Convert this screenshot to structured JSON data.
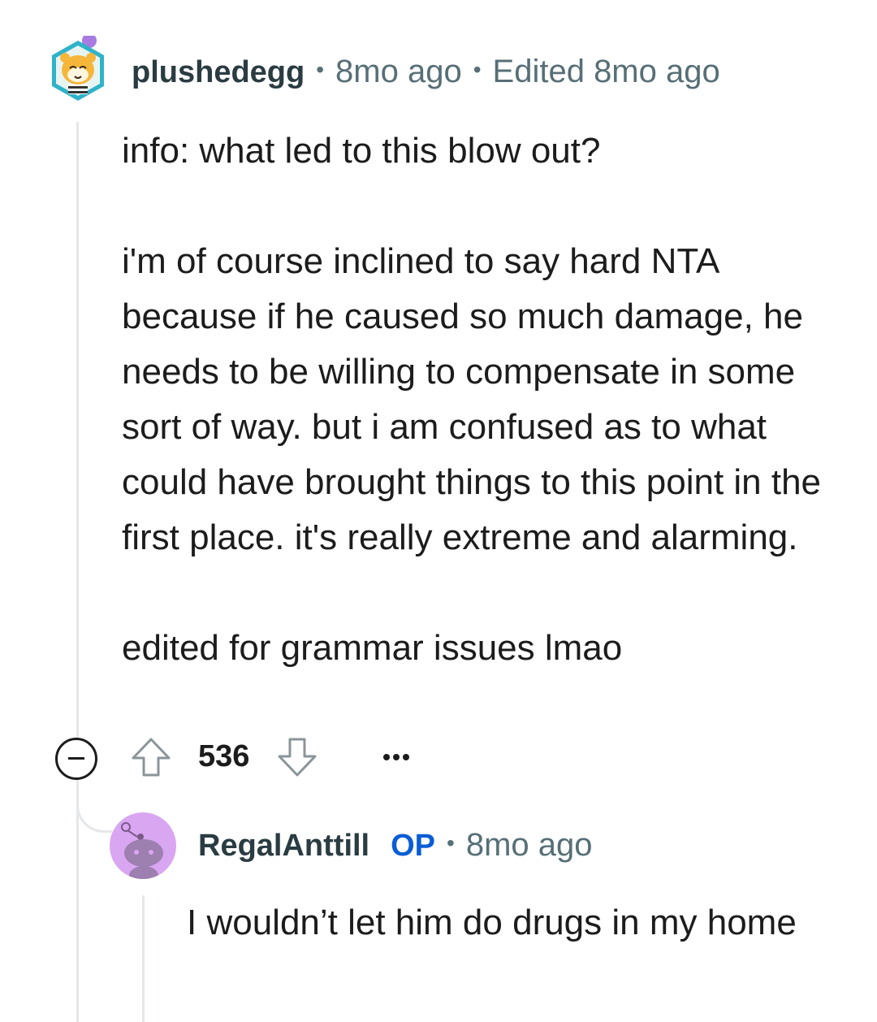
{
  "comment": {
    "username": "plushedegg",
    "posted": "8mo ago",
    "edited": "Edited 8mo ago",
    "paragraphs": [
      "info: what led to this blow out?",
      "i'm of course inclined to say hard NTA because if he caused so much damage, he needs to be willing to compensate in some sort of way. but i am confused as to what could have brought things to this point in the first place. it's really extreme and alarming.",
      "edited for grammar issues lmao"
    ],
    "score": "536",
    "avatar_icon": "tiger-avatar-icon"
  },
  "reply": {
    "username": "RegalAnttill",
    "badge": "OP",
    "posted": "8mo ago",
    "text": "I wouldn’t let him do drugs in my home",
    "avatar_icon": "snoo-avatar-icon"
  },
  "colors": {
    "meta": "#576f76",
    "op_badge": "#0a5dd4",
    "thread_line": "#e5e7e9",
    "reply_avatar_bg": "#d9a6f2"
  }
}
